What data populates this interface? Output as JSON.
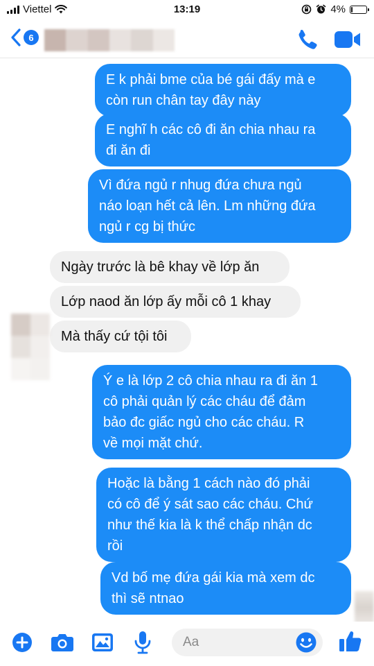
{
  "status_bar": {
    "carrier": "Viettel",
    "time": "13:19",
    "battery_percent": "4%",
    "battery_level": 0.04,
    "icons": [
      "signal-bars-icon",
      "wifi-icon",
      "orientation-lock-icon",
      "alarm-icon",
      "battery-icon"
    ]
  },
  "header": {
    "back_count": "6",
    "contact_name_blurred": true,
    "icons": [
      "back-chevron-icon",
      "phone-call-icon",
      "video-call-icon"
    ]
  },
  "messages": [
    {
      "direction": "outgoing",
      "lines": [
        "E k phải bme của bé gái đấy mà e",
        "còn run chân tay đây này"
      ]
    },
    {
      "direction": "outgoing",
      "lines": [
        "E nghĩ h các cô đi ăn chia nhau ra",
        "đi ăn đi"
      ]
    },
    {
      "direction": "outgoing",
      "lines": [
        "Vì đứa ngủ r nhug đứa chưa ngủ",
        "náo loạn hết cả lên. Lm những đứa",
        "ngủ r cg bị thức"
      ]
    },
    {
      "direction": "incoming",
      "lines": [
        "Ngày trước là bê khay về lớp ăn"
      ]
    },
    {
      "direction": "incoming",
      "lines": [
        "Lớp naod ăn lớp ấy mỗi cô 1 khay"
      ]
    },
    {
      "direction": "incoming",
      "lines": [
        "Mà thấy cứ tội tôi"
      ]
    },
    {
      "direction": "outgoing",
      "lines": [
        "Ý e là lớp 2 cô chia nhau ra đi ăn 1",
        "cô phải quản lý các cháu để đảm",
        "bảo đc giấc ngủ cho các cháu. R",
        "về mọi mặt chứ."
      ]
    },
    {
      "direction": "outgoing",
      "lines": [
        "Hoặc là bằng 1 cách nào đó phải",
        "có cô để ý sát sao các cháu. Chứ",
        "như thế kia là k thể chấp nhận dc",
        "rồi"
      ]
    },
    {
      "direction": "outgoing",
      "lines": [
        "Vd bố mẹ đứa gái kia mà xem dc",
        "thì sẽ ntnao"
      ]
    }
  ],
  "composer": {
    "placeholder": "Aa",
    "icons": [
      "plus-icon",
      "camera-icon",
      "photo-icon",
      "microphone-icon",
      "emoji-icon",
      "thumbs-up-icon"
    ]
  },
  "colors": {
    "accent": "#1877f2",
    "outgoing_bubble": "#1c8cf7",
    "incoming_bubble": "#f0f0f0"
  }
}
